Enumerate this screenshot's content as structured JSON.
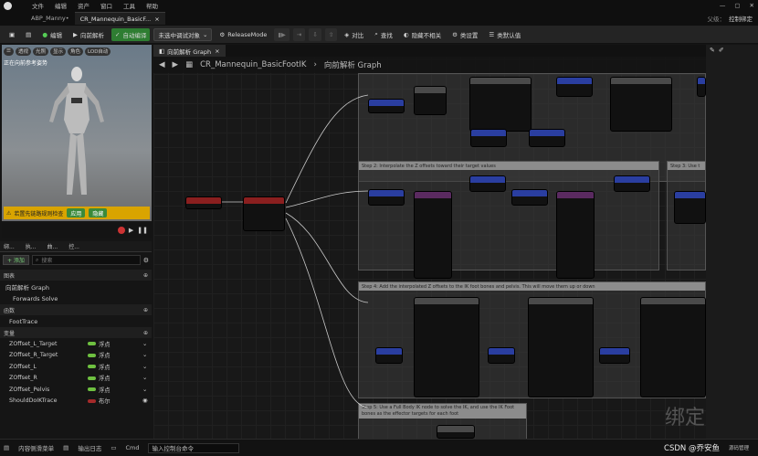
{
  "menu": [
    "文件",
    "编辑",
    "资产",
    "窗口",
    "工具",
    "帮助"
  ],
  "window": {
    "right_label": "父级：",
    "right_label2": "控制绑定"
  },
  "tabs": [
    {
      "label": "ABP_Manny•"
    },
    {
      "label": "CR_Mannequin_BasicF...",
      "close": "×"
    }
  ],
  "toolbar": {
    "compile": "编辑",
    "forward": "向前解析",
    "autocompile": "自动编译",
    "debug_select": "未选中调试对象",
    "release_mode": "ReleaseMode",
    "compare": "对比",
    "find": "查找",
    "hide_unrelated": "隐藏不相关",
    "class_settings": "类设置",
    "class_defaults": "类默认值"
  },
  "viewport": {
    "buttons": [
      "透视",
      "光照",
      "显示",
      "角色",
      "LOD自动"
    ],
    "caption": "正在向前参考姿势",
    "warning": "若置先链路规则检查",
    "w_btn1": "应用",
    "w_btn2": "隐藏"
  },
  "panel": {
    "tabs": [
      "绑...",
      "执...",
      "曲...",
      "控..."
    ],
    "add": "+ 添加",
    "search_placeholder": "搜索"
  },
  "sections": {
    "graph": "图表",
    "functions": "函数",
    "variables": "变量"
  },
  "graph_items": [
    "向前解析 Graph",
    "Forwards Solve"
  ],
  "function_items": [
    "FootTrace"
  ],
  "variables": [
    {
      "name": "ZOffset_L_Target",
      "type": "浮点",
      "color": "green"
    },
    {
      "name": "ZOffset_R_Target",
      "type": "浮点",
      "color": "green"
    },
    {
      "name": "ZOffset_L",
      "type": "浮点",
      "color": "green"
    },
    {
      "name": "ZOffset_R",
      "type": "浮点",
      "color": "green"
    },
    {
      "name": "ZOffset_Pelvis",
      "type": "浮点",
      "color": "green"
    },
    {
      "name": "ShouldDoIKTrace",
      "type": "布尔",
      "color": "red"
    }
  ],
  "graph": {
    "tab": "向前解析 Graph",
    "breadcrumb_root": "CR_Mannequin_BasicFootIK",
    "breadcrumb_leaf": "向前解析 Graph",
    "comments": [
      "Step 2: Interpolate the Z offsets toward their target values",
      "Step 3: Use t",
      "Step 4: Add the interpolated Z offsets to the IK foot bones and pelvis. This will move them up or down",
      "Step 5: Use a Full Body IK node to solve the IK, and use the IK Foot bones as the effector targets for each foot"
    ],
    "watermark": "绑定"
  },
  "status": {
    "content": "内容侧滑菜单",
    "output": "输出日志",
    "cmd": "Cmd",
    "cmd_placeholder": "输入控制台命令",
    "csdn": "CSDN @乔安鱼",
    "right": "源码管理"
  }
}
